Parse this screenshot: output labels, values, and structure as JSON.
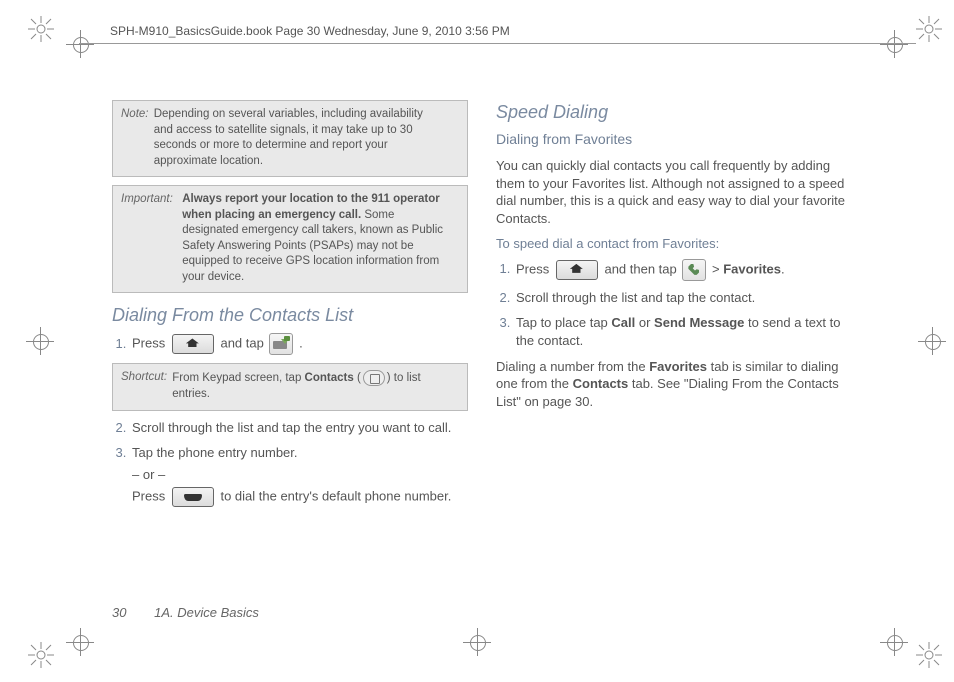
{
  "header": {
    "doc_stamp": "SPH-M910_BasicsGuide.book  Page 30  Wednesday, June 9, 2010  3:56 PM"
  },
  "left": {
    "note": {
      "label": "Note:",
      "text": "Depending on several variables, including availability and access to satellite signals, it may take up to 30 seconds or more to determine and report your approximate location."
    },
    "important": {
      "label": "Important:",
      "bold_lead": "Always report your location to the 911 operator when placing an emergency call.",
      "rest": " Some designated emergency call takers, known as Public Safety Answering Points (PSAPs) may not be equipped to receive GPS location information from your device."
    },
    "section_title": "Dialing From the Contacts List",
    "step1_a": "Press ",
    "step1_b": " and tap ",
    "step1_c": " .",
    "shortcut": {
      "label": "Shortcut:",
      "a": "From Keypad screen, tap ",
      "contacts": "Contacts",
      "b": " (",
      "c": ") to list entries."
    },
    "step2": "Scroll through the list and tap the entry you want to call.",
    "step3": "Tap the phone entry number.",
    "or": "– or –",
    "step3b_a": "Press ",
    "step3b_b": " to dial the entry's default phone number."
  },
  "right": {
    "section_title": "Speed Dialing",
    "sub_title": "Dialing from Favorites",
    "intro": "You can quickly dial contacts you call frequently by adding them to your Favorites list. Although not assigned to a speed dial number, this is a quick and easy way to dial your favorite Contacts.",
    "lead": "To speed dial a contact from Favorites:",
    "s1_a": "Press ",
    "s1_b": " and then tap ",
    "s1_c": "  > ",
    "s1_fav": "Favorites",
    "s1_d": ".",
    "s2": "Scroll through the list and tap the contact.",
    "s3_a": "Tap to place tap ",
    "s3_call": "Call",
    "s3_b": " or ",
    "s3_send": "Send Message",
    "s3_c": " to send a text to the contact.",
    "tail_a": "Dialing a number from the ",
    "tail_fav": "Favorites",
    "tail_b": " tab is similar to dialing one from the ",
    "tail_con": "Contacts",
    "tail_c": " tab. See \"Dialing From the Contacts List\" on page 30."
  },
  "footer": {
    "page_number": "30",
    "chapter": "1A. Device Basics"
  }
}
